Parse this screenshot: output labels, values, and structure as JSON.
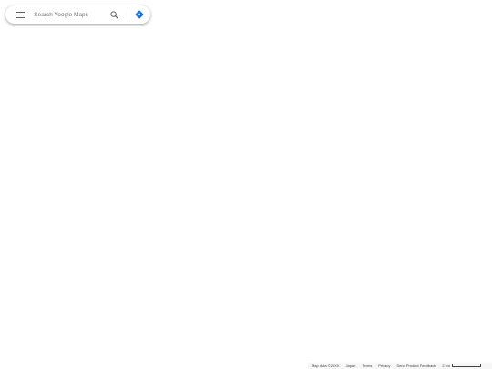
{
  "search": {
    "placeholder": "Search Yoogle Maps",
    "menu_icon": "hamburger-menu-icon",
    "search_icon": "magnifier-icon",
    "directions_icon": "directions-icon"
  },
  "colors": {
    "directions_blue": "#1a73e8",
    "icon_gray": "#5f6368",
    "map_background": "#ffffff"
  },
  "footer": {
    "map_data": "Map data ©20XX",
    "region": "Japan",
    "terms": "Terms",
    "privacy": "Privacy",
    "feedback": "Send Product Feedback",
    "scale_label": "2 km"
  }
}
